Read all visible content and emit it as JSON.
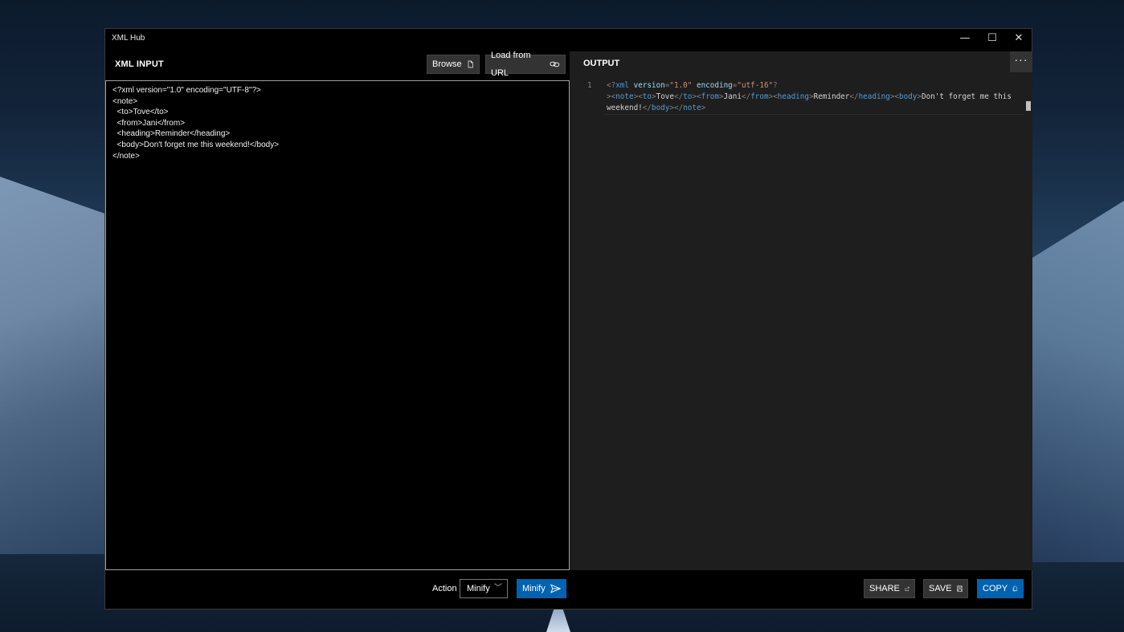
{
  "window": {
    "title": "XML Hub",
    "minimize_glyph": "—",
    "maximize_glyph": "☐",
    "close_glyph": "✕"
  },
  "input_panel": {
    "label": "XML INPUT",
    "browse_label": "Browse",
    "browse_icon": "file-icon",
    "load_url_label": "Load from URL",
    "load_url_icon": "link-icon",
    "text": "<?xml version=\"1.0\" encoding=\"UTF-8\"?>\n<note>\n  <to>Tove</to>\n  <from>Jani</from>\n  <heading>Reminder</heading>\n  <body>Don't forget me this weekend!</body>\n</note>"
  },
  "output_panel": {
    "label": "OUTPUT",
    "more_glyph": "···",
    "line_number": "1",
    "code_lines": [
      [
        {
          "cls": "t-pun",
          "text": "<?"
        },
        {
          "cls": "t-tag",
          "text": "xml "
        },
        {
          "cls": "t-attr",
          "text": "version"
        },
        {
          "cls": "t-pun",
          "text": "="
        },
        {
          "cls": "t-str",
          "text": "\"1.0\" "
        },
        {
          "cls": "t-attr",
          "text": "encoding"
        },
        {
          "cls": "t-pun",
          "text": "="
        },
        {
          "cls": "t-str",
          "text": "\"utf-16\""
        },
        {
          "cls": "t-pun",
          "text": "?"
        }
      ],
      [
        {
          "cls": "t-pun",
          "text": "><"
        },
        {
          "cls": "t-tag",
          "text": "note"
        },
        {
          "cls": "t-pun",
          "text": "><"
        },
        {
          "cls": "t-tag",
          "text": "to"
        },
        {
          "cls": "t-pun",
          "text": ">"
        },
        {
          "cls": "t-txt",
          "text": "Tove"
        },
        {
          "cls": "t-pun",
          "text": "</"
        },
        {
          "cls": "t-tag",
          "text": "to"
        },
        {
          "cls": "t-pun",
          "text": "><"
        },
        {
          "cls": "t-tag",
          "text": "from"
        },
        {
          "cls": "t-pun",
          "text": ">"
        },
        {
          "cls": "t-txt",
          "text": "Jani"
        },
        {
          "cls": "t-pun",
          "text": "</"
        },
        {
          "cls": "t-tag",
          "text": "from"
        },
        {
          "cls": "t-pun",
          "text": "><"
        },
        {
          "cls": "t-tag",
          "text": "heading"
        },
        {
          "cls": "t-pun",
          "text": ">"
        },
        {
          "cls": "t-txt",
          "text": "Reminder"
        },
        {
          "cls": "t-pun",
          "text": "</"
        },
        {
          "cls": "t-tag",
          "text": "heading"
        },
        {
          "cls": "t-pun",
          "text": "><"
        },
        {
          "cls": "t-tag",
          "text": "body"
        },
        {
          "cls": "t-pun",
          "text": ">"
        },
        {
          "cls": "t-txt",
          "text": "Don't forget me this"
        }
      ],
      [
        {
          "cls": "t-txt",
          "text": "weekend!"
        },
        {
          "cls": "t-pun",
          "text": "</"
        },
        {
          "cls": "t-tag",
          "text": "body"
        },
        {
          "cls": "t-pun",
          "text": "></"
        },
        {
          "cls": "t-tag",
          "text": "note"
        },
        {
          "cls": "t-pun",
          "text": ">"
        }
      ]
    ]
  },
  "footer": {
    "action_label": "Action",
    "action_select_value": "Minify",
    "run_label": "Minify",
    "run_icon": "send-icon",
    "share_label": "SHARE",
    "share_icon": "share-icon",
    "save_label": "SAVE",
    "save_icon": "save-icon",
    "copy_label": "COPY",
    "copy_icon": "copy-icon"
  },
  "colors": {
    "accent": "#0063b1",
    "button_bg": "#333333",
    "editor_bg": "#1e1e1e",
    "tag": "#569cd6",
    "attr": "#9cdcfe",
    "string": "#ce9178"
  }
}
